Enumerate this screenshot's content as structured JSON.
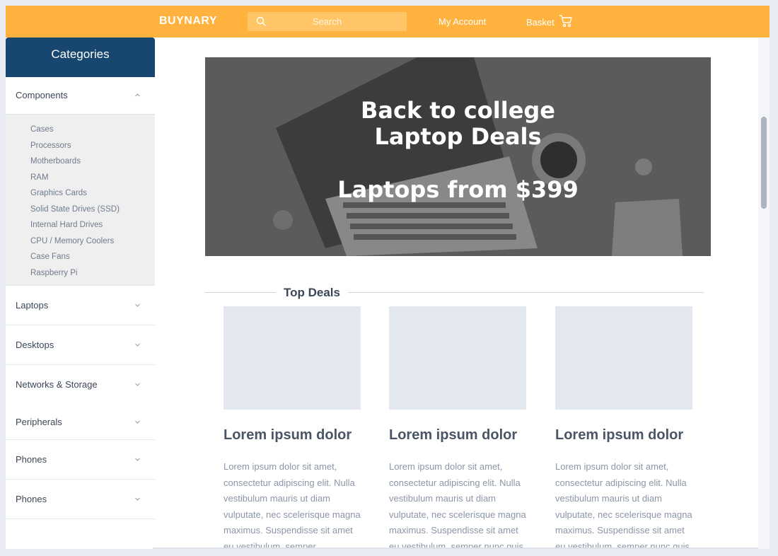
{
  "header": {
    "brand": "BUYNARY",
    "search_placeholder": "Search",
    "my_account": "My Account",
    "basket": "Basket"
  },
  "sidebar": {
    "title": "Categories",
    "open_category": "Components",
    "subitems": [
      "Cases",
      "Processors",
      "Motherboards",
      "RAM",
      "Graphics Cards",
      "Solid State Drives (SSD)",
      "Internal Hard Drives",
      "CPU / Memory Coolers",
      "Case Fans",
      "Raspberry Pi"
    ],
    "categories": [
      "Laptops",
      "Desktops",
      "Networks & Storage",
      "Peripherals",
      "Phones",
      "Phones"
    ]
  },
  "hero": {
    "line1": "Back to college",
    "line2": "Laptop Deals",
    "line3": "Laptops from $399"
  },
  "deals": {
    "title": "Top Deals",
    "cards": [
      {
        "title": "Lorem ipsum dolor",
        "text": "Lorem ipsum dolor sit amet, consectetur adipiscing elit. Nulla vestibulum mauris ut diam vulputate, nec scelerisque magna maximus. Suspendisse sit amet eu vestibulum, semper"
      },
      {
        "title": "Lorem ipsum dolor",
        "text": "Lorem ipsum dolor sit amet, consectetur adipiscing elit. Nulla vestibulum mauris ut diam vulputate, nec scelerisque magna maximus. Suspendisse sit amet eu vestibulum, semper nunc quis"
      },
      {
        "title": "Lorem ipsum dolor",
        "text": "Lorem ipsum dolor sit amet, consectetur adipiscing elit. Nulla vestibulum mauris ut diam vulputate, nec scelerisque magna maximus. Suspendisse sit amet eu vestibulum, semper nunc quis"
      }
    ]
  }
}
